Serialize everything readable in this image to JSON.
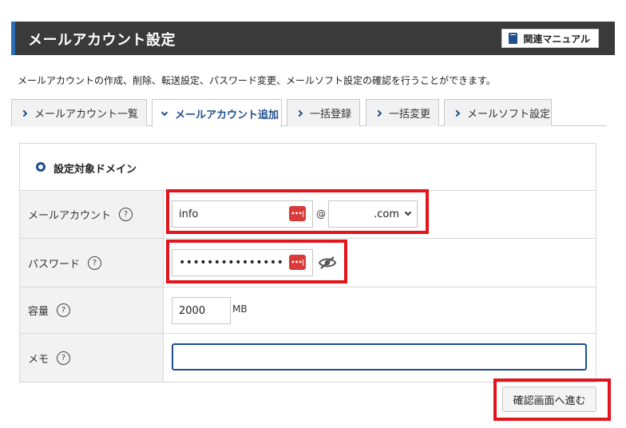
{
  "header": {
    "title": "メールアカウント設定",
    "manual_label": "関連マニュアル"
  },
  "description": "メールアカウントの作成、削除、転送設定、パスワード変更、メールソフト設定の確認を行うことができます。",
  "tabs": [
    {
      "label": "メールアカウント一覧",
      "active": false
    },
    {
      "label": "メールアカウント追加",
      "active": true
    },
    {
      "label": "一括登録",
      "active": false
    },
    {
      "label": "一括変更",
      "active": false
    },
    {
      "label": "メールソフト設定",
      "active": false
    }
  ],
  "form": {
    "domain_label": "設定対象ドメイン",
    "account": {
      "label": "メールアカウント",
      "value": "info",
      "at": "@",
      "domain_value": ".com"
    },
    "password": {
      "label": "パスワード",
      "value": "•••••••••••••••"
    },
    "capacity": {
      "label": "容量",
      "value": "2000",
      "unit": "MB"
    },
    "memo": {
      "label": "メモ",
      "value": ""
    },
    "help_glyph": "?",
    "key_glyph": "•••|"
  },
  "confirm_button": "確認画面へ進む",
  "colors": {
    "header_bg": "#3a3a3a",
    "accent": "#1e4f8e",
    "highlight": "#e2141c",
    "key_icon": "#d93a3a"
  }
}
